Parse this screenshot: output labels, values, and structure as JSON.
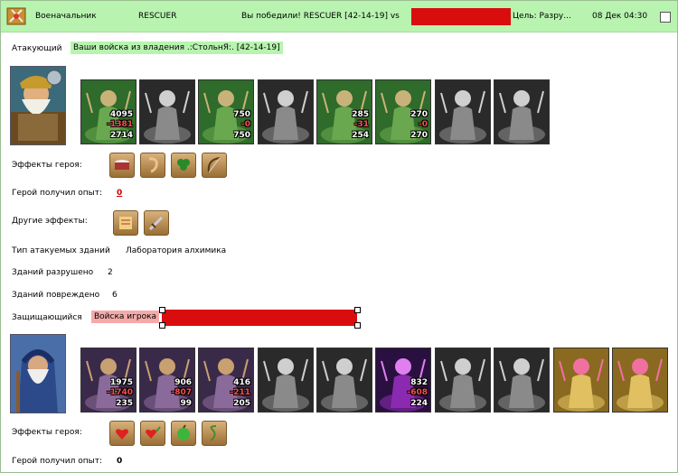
{
  "header": {
    "role": "Военачальник",
    "player": "RESCUER",
    "result": "Вы победили! RESCUER [42-14-19] vs",
    "target": "Цель: Разру...",
    "datetime": "08 Дек 04:30"
  },
  "attacker": {
    "label": "Атакующий",
    "army_name": "Ваши войска из владения .:СтольнЯ:. [42-14-19]",
    "hero_effects_label": "Эффекты героя:",
    "exp_label": "Герой получил опыт:",
    "exp_value": "0",
    "other_effects_label": "Другие эффекты:",
    "units": [
      {
        "name": "dwarf-gunner-unit",
        "count": "4095",
        "loss": "-1381",
        "left": "2714",
        "color": "green"
      },
      {
        "name": "dark-knight-unit",
        "count": "",
        "loss": "",
        "left": "",
        "color": "gray"
      },
      {
        "name": "spearman-unit",
        "count": "750",
        "loss": "-0",
        "left": "750",
        "color": "green"
      },
      {
        "name": "griffin-unit",
        "count": "",
        "loss": "",
        "left": "",
        "color": "gray"
      },
      {
        "name": "archer-unit",
        "count": "285",
        "loss": "-31",
        "left": "254",
        "color": "green"
      },
      {
        "name": "elf-mage-unit",
        "count": "270",
        "loss": "-0",
        "left": "270",
        "color": "green"
      },
      {
        "name": "hooded-monk-unit",
        "count": "",
        "loss": "",
        "left": "",
        "color": "gray"
      },
      {
        "name": "sorceress-unit",
        "count": "",
        "loss": "",
        "left": "",
        "color": "gray"
      }
    ],
    "hero_effects": [
      "drum-icon",
      "ear-icon",
      "clover-icon",
      "bow-icon"
    ],
    "other_effects": [
      "scroll-icon",
      "sword-icon"
    ]
  },
  "buildings": {
    "type_label": "Тип атакуемых зданий",
    "type_value": "Лаборатория алхимика",
    "destroyed_label": "Зданий разрушено",
    "destroyed_value": "2",
    "damaged_label": "Зданий повреждено",
    "damaged_value": "6"
  },
  "defender": {
    "label": "Защищающийся",
    "army_name": "Войска игрока",
    "hero_effects_label": "Эффекты героя:",
    "exp_label": "Герой получил опыт:",
    "exp_value": "0",
    "units": [
      {
        "name": "ogre-unit",
        "count": "1975",
        "loss": "-1740",
        "left": "235",
        "color": "color"
      },
      {
        "name": "assassin-unit",
        "count": "906",
        "loss": "-807",
        "left": "99",
        "color": "color"
      },
      {
        "name": "dragon-rider-unit",
        "count": "416",
        "loss": "-211",
        "left": "205",
        "color": "color"
      },
      {
        "name": "wyvern-unit",
        "count": "",
        "loss": "",
        "left": "",
        "color": "gray"
      },
      {
        "name": "dark-archer-unit",
        "count": "",
        "loss": "",
        "left": "",
        "color": "gray"
      },
      {
        "name": "warlock-unit",
        "count": "832",
        "loss": "-608",
        "left": "224",
        "color": "purple"
      },
      {
        "name": "black-knight-unit",
        "count": "",
        "loss": "",
        "left": "",
        "color": "gray"
      },
      {
        "name": "spider-unit",
        "count": "",
        "loss": "",
        "left": "",
        "color": "gray"
      },
      {
        "name": "pink-dragon-unit",
        "count": "",
        "loss": "",
        "left": "",
        "color": "gold"
      },
      {
        "name": "pink-dragon-unit-2",
        "count": "",
        "loss": "",
        "left": "",
        "color": "gold"
      }
    ],
    "hero_effects": [
      "heart-icon",
      "double-heart-icon",
      "apple-icon",
      "vine-icon"
    ]
  },
  "colors": {
    "header_bg": "#b8f4b0",
    "attacker_tag": "#b8f4b0",
    "defender_tag": "#f5aaaa",
    "redacted": "#d90d0d",
    "loss": "#ff4d4d"
  }
}
